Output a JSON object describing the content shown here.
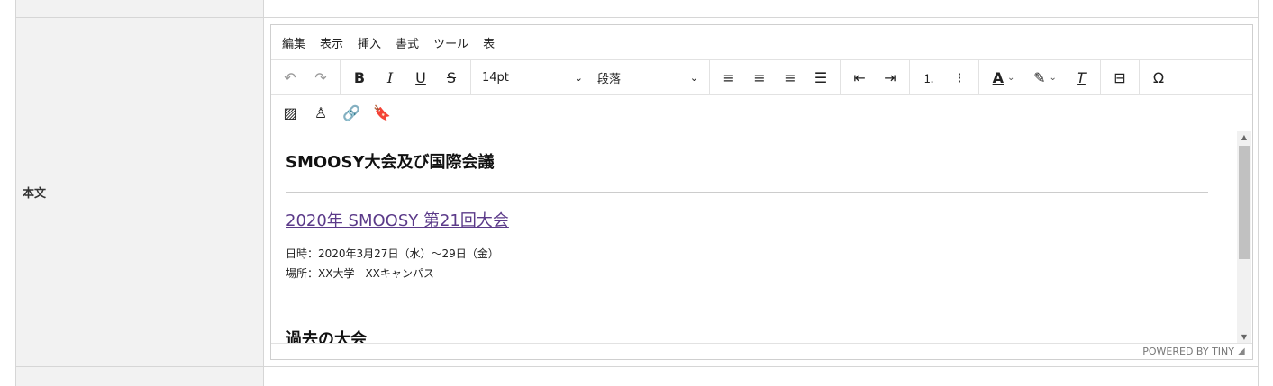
{
  "field": {
    "label": "本文"
  },
  "menubar": [
    "編集",
    "表示",
    "挿入",
    "書式",
    "ツール",
    "表"
  ],
  "toolbar": {
    "font_size": "14pt",
    "block_format": "段落"
  },
  "content": {
    "heading": "SMOOSY大会及び国際会議",
    "link_text": "2020年 SMOOSY 第21回大会",
    "date_line": "日時：2020年3月27日（水）～29日（金）",
    "place_line": "場所：XX大学　XXキャンパス",
    "heading2": "過去の大会"
  },
  "statusbar": {
    "powered_by": "POWERED BY TINY"
  },
  "colors": {
    "link": "#5b3a89",
    "label_bg": "#f2f2f2",
    "border": "#d6d6d6"
  }
}
